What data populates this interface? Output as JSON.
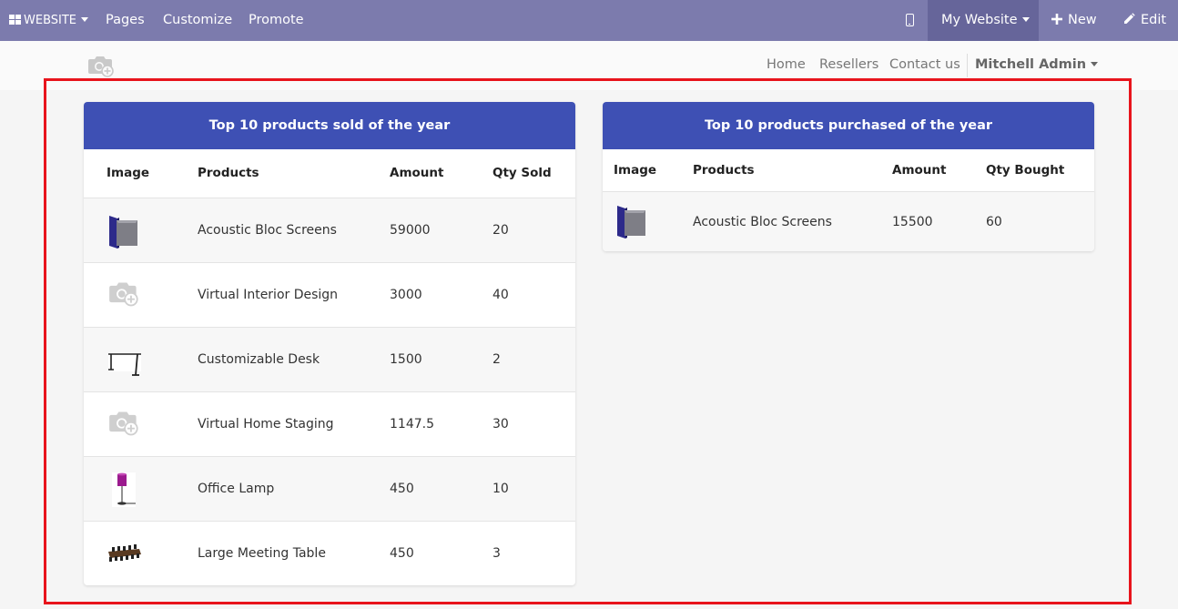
{
  "topbar": {
    "website_label": "WEBSITE",
    "menu": [
      "Pages",
      "Customize",
      "Promote"
    ],
    "mobile_icon": "mobile-phone-icon",
    "my_website_label": "My Website",
    "new_label": "New",
    "edit_label": "Edit",
    "bar_color": "#7c7bad"
  },
  "site_header": {
    "logo_icon": "camera-plus-icon",
    "nav": [
      "Home",
      "Resellers",
      "Contact us"
    ],
    "user": "Mitchell Admin"
  },
  "sold_table": {
    "title": "Top 10 products sold of the year",
    "headers": [
      "Image",
      "Products",
      "Amount",
      "Qty Sold"
    ],
    "rows": [
      {
        "image": "acoustic-screen-thumbnail",
        "product": "Acoustic Bloc Screens",
        "amount": "59000",
        "qty": "20"
      },
      {
        "image": "camera-placeholder-icon",
        "product": "Virtual Interior Design",
        "amount": "3000",
        "qty": "40"
      },
      {
        "image": "desk-thumbnail",
        "product": "Customizable Desk",
        "amount": "1500",
        "qty": "2"
      },
      {
        "image": "camera-placeholder-icon",
        "product": "Virtual Home Staging",
        "amount": "1147.5",
        "qty": "30"
      },
      {
        "image": "lamp-thumbnail",
        "product": "Office Lamp",
        "amount": "450",
        "qty": "10"
      },
      {
        "image": "meeting-table-thumbnail",
        "product": "Large Meeting Table",
        "amount": "450",
        "qty": "3"
      }
    ]
  },
  "purchased_table": {
    "title": "Top 10 products purchased of the year",
    "headers": [
      "Image",
      "Products",
      "Amount",
      "Qty Bought"
    ],
    "rows": [
      {
        "image": "acoustic-screen-thumbnail",
        "product": "Acoustic Bloc Screens",
        "amount": "15500",
        "qty": "60"
      }
    ]
  },
  "colors": {
    "accent": "#3e50b4",
    "highlight": "#e8141c"
  }
}
